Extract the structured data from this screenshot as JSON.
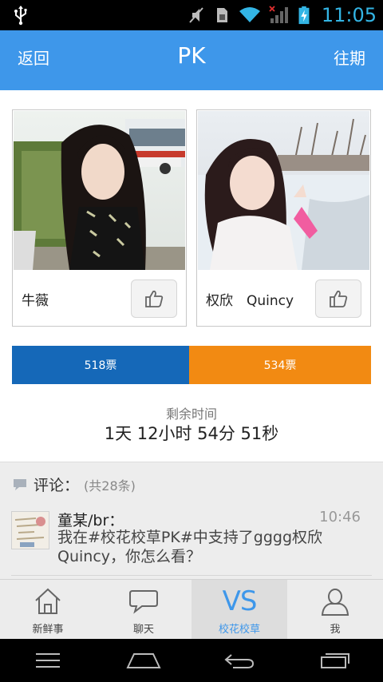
{
  "status_bar": {
    "time": "11:05",
    "icons": [
      "usb-icon",
      "mute-icon",
      "sim-icon",
      "wifi-icon",
      "signal-icon",
      "battery-icon"
    ],
    "accent": "#33b5e5"
  },
  "header": {
    "back_label": "返回",
    "title": "PK",
    "history_label": "往期",
    "color": "#3e97ea"
  },
  "contestants": [
    {
      "name": "牛薇",
      "like_icon": "thumbs-up-icon"
    },
    {
      "name": "权欣　Quincy",
      "like_icon": "thumbs-up-icon"
    }
  ],
  "votes": {
    "left_label": "518票",
    "right_label": "534票",
    "left_color": "#1568b8",
    "right_color": "#f28a12"
  },
  "countdown": {
    "label": "剩余时间",
    "value": "1天 12小时 54分 51秒"
  },
  "comments": {
    "label": "评论：",
    "count": "(共28条)",
    "items": [
      {
        "author": "童某/br：",
        "time": "10:46",
        "text": "我在#校花校草PK#中支持了gggg权欣Quincy，你怎么看？"
      }
    ]
  },
  "tabs": [
    {
      "label": "新鲜事",
      "icon": "home-icon"
    },
    {
      "label": "聊天",
      "icon": "chat-icon"
    },
    {
      "label": "校花校草",
      "icon": "vs-icon",
      "glyph": "VS",
      "active": true
    },
    {
      "label": "我",
      "icon": "person-icon"
    }
  ],
  "system_nav": [
    "menu-icon",
    "home-icon",
    "back-icon",
    "recents-icon"
  ]
}
